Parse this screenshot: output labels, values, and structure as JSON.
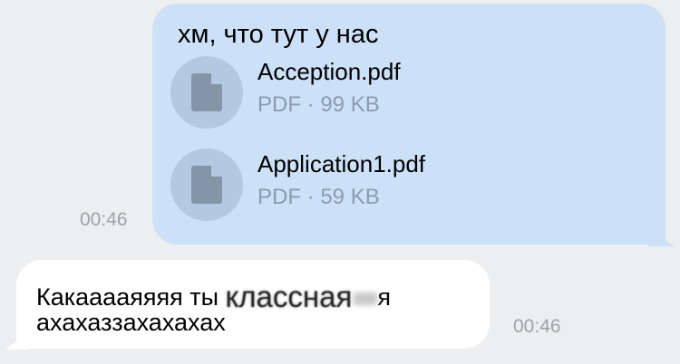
{
  "messages": {
    "outgoing": {
      "text": "хм, что тут у нас",
      "time": "00:46",
      "attachments": [
        {
          "name": "Acception.pdf",
          "meta": "PDF · 99 KB",
          "icon": "document-icon"
        },
        {
          "name": "Application1.pdf",
          "meta": "PDF · 59 KB",
          "icon": "document-icon"
        }
      ]
    },
    "incoming": {
      "line1_start": "Какааааяяяя ты ",
      "line1_obscured": "классная",
      "line1_end": "я",
      "line2": "ахахаззахахахах",
      "time": "00:46"
    }
  },
  "colors": {
    "outgoing_bubble": "#cce0f8",
    "incoming_bubble": "#ffffff",
    "background": "#edeef0",
    "attachment_circle": "#b3c9e2",
    "doc_icon": "#8495a8",
    "meta_text": "#8a9bae"
  }
}
